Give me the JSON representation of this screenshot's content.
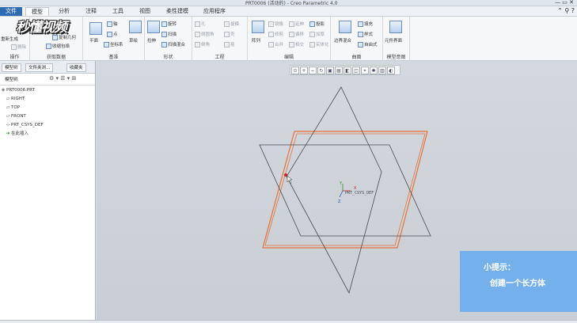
{
  "window": {
    "title": "PRT0006 (活动的) - Creo Parametric 4.0"
  },
  "menu": {
    "file": "文件",
    "tabs": [
      "模型",
      "分析",
      "注释",
      "工具",
      "视图",
      "柔性建模",
      "应用程序"
    ],
    "active_index": 0
  },
  "ribbon": {
    "groups": {
      "operations": {
        "label": "操作",
        "items": [
          "重新生成",
          "删除"
        ]
      },
      "get_data": {
        "label": "获取数据",
        "items": [
          "复制几何",
          "收缩包络"
        ]
      },
      "datum": {
        "label": "基准",
        "items": [
          "平面",
          "轴",
          "点",
          "坐标系"
        ]
      },
      "shapes": {
        "label": "形状",
        "items": [
          "草绘",
          "拉伸",
          "旋转",
          "扫描",
          "扫描混合"
        ]
      },
      "engineering": {
        "label": "工程",
        "items": [
          "孔",
          "倒圆角",
          "倒角",
          "拔模",
          "壳",
          "筋"
        ]
      },
      "editing": {
        "label": "编辑",
        "items": [
          "阵列",
          "镜像",
          "修剪",
          "合并",
          "相交",
          "延伸",
          "偏移",
          "投影",
          "加厚",
          "实体化"
        ]
      },
      "surfaces": {
        "label": "曲面",
        "items": [
          "边界混合",
          "填充",
          "样式",
          "自由式"
        ]
      },
      "model_intent": {
        "label": "模型意图",
        "items": [
          "元件界面"
        ]
      }
    }
  },
  "watermark": "秒懂视频",
  "sidebar": {
    "tabs": [
      "模型树",
      "文件夹浏...",
      "收藏夹"
    ],
    "header": "模型树",
    "tree": [
      {
        "label": "PRT0006.PRT",
        "icon": "part-icon"
      },
      {
        "label": "RIGHT",
        "icon": "datum-plane-icon"
      },
      {
        "label": "TOP",
        "icon": "datum-plane-icon"
      },
      {
        "label": "FRONT",
        "icon": "datum-plane-icon"
      },
      {
        "label": "PRT_CSYS_DEF",
        "icon": "csys-icon"
      },
      {
        "label": "在此插入",
        "icon": "insert-arrow-icon"
      }
    ]
  },
  "view_toolbar": [
    "zoom-fit-icon",
    "zoom-in-icon",
    "zoom-out-icon",
    "repaint-icon",
    "view-orient-icon",
    "saved-views-icon",
    "display-style-icon",
    "section-icon",
    "datum-display-icon",
    "spin-center-icon",
    "annotation-icon",
    "appearance-icon"
  ],
  "canvas": {
    "csys_label": "PRT_CSYS_DEF",
    "axes": [
      "Y",
      "X",
      "Z"
    ]
  },
  "tip": {
    "title": "小提示：",
    "body": "创建一个长方体",
    "color": "#73b0ec"
  }
}
